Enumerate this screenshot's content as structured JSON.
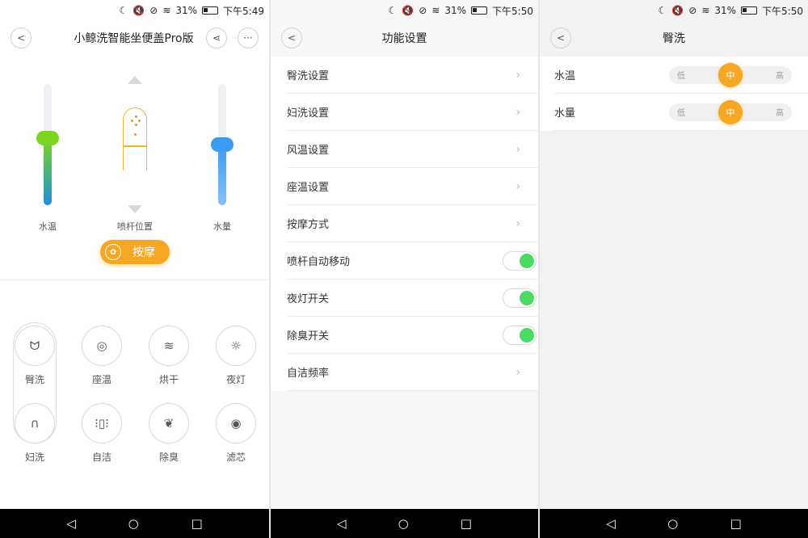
{
  "status_bar_1": {
    "battery": "31%",
    "time": "下午5:49"
  },
  "status_bar_2": {
    "battery": "31%",
    "time": "下午5:50"
  },
  "status_bar_3": {
    "battery": "31%",
    "time": "下午5:50"
  },
  "device": {
    "title": "小鲸洗智能坐便盖Pro版",
    "sliders": [
      {
        "label": "水温",
        "level": 0.55,
        "color": "#7dd51f"
      },
      {
        "label": "喷杆位置"
      },
      {
        "label": "水量",
        "level": 0.5,
        "color": "#3a9bf0"
      }
    ],
    "massage_label": "按摩",
    "modes": [
      {
        "label": "臀洗",
        "icon": "bidet-rear-icon"
      },
      {
        "label": "座温",
        "icon": "seat-temp-icon"
      },
      {
        "label": "烘干",
        "icon": "dry-icon"
      },
      {
        "label": "夜灯",
        "icon": "night-light-icon"
      },
      {
        "label": "妇洗",
        "icon": "bidet-front-icon"
      },
      {
        "label": "自洁",
        "icon": "self-clean-icon"
      },
      {
        "label": "除臭",
        "icon": "deodorize-icon"
      },
      {
        "label": "滤芯",
        "icon": "filter-icon"
      }
    ]
  },
  "settings": {
    "title": "功能设置",
    "items": [
      {
        "label": "臀洗设置",
        "type": "link"
      },
      {
        "label": "妇洗设置",
        "type": "link"
      },
      {
        "label": "风温设置",
        "type": "link"
      },
      {
        "label": "座温设置",
        "type": "link"
      },
      {
        "label": "按摩方式",
        "type": "link"
      },
      {
        "label": "喷杆自动移动",
        "type": "toggle",
        "on": true
      },
      {
        "label": "夜灯开关",
        "type": "toggle",
        "on": true
      },
      {
        "label": "除臭开关",
        "type": "toggle",
        "on": true
      },
      {
        "label": "自洁频率",
        "type": "link"
      }
    ]
  },
  "rear_wash": {
    "title": "臀洗",
    "rows": [
      {
        "label": "水温",
        "options": [
          "低",
          "中",
          "高"
        ],
        "selected": "中"
      },
      {
        "label": "水量",
        "options": [
          "低",
          "中",
          "高"
        ],
        "selected": "中"
      }
    ]
  },
  "colors": {
    "accent": "#f5a623",
    "toggle_on": "#4cd964"
  }
}
